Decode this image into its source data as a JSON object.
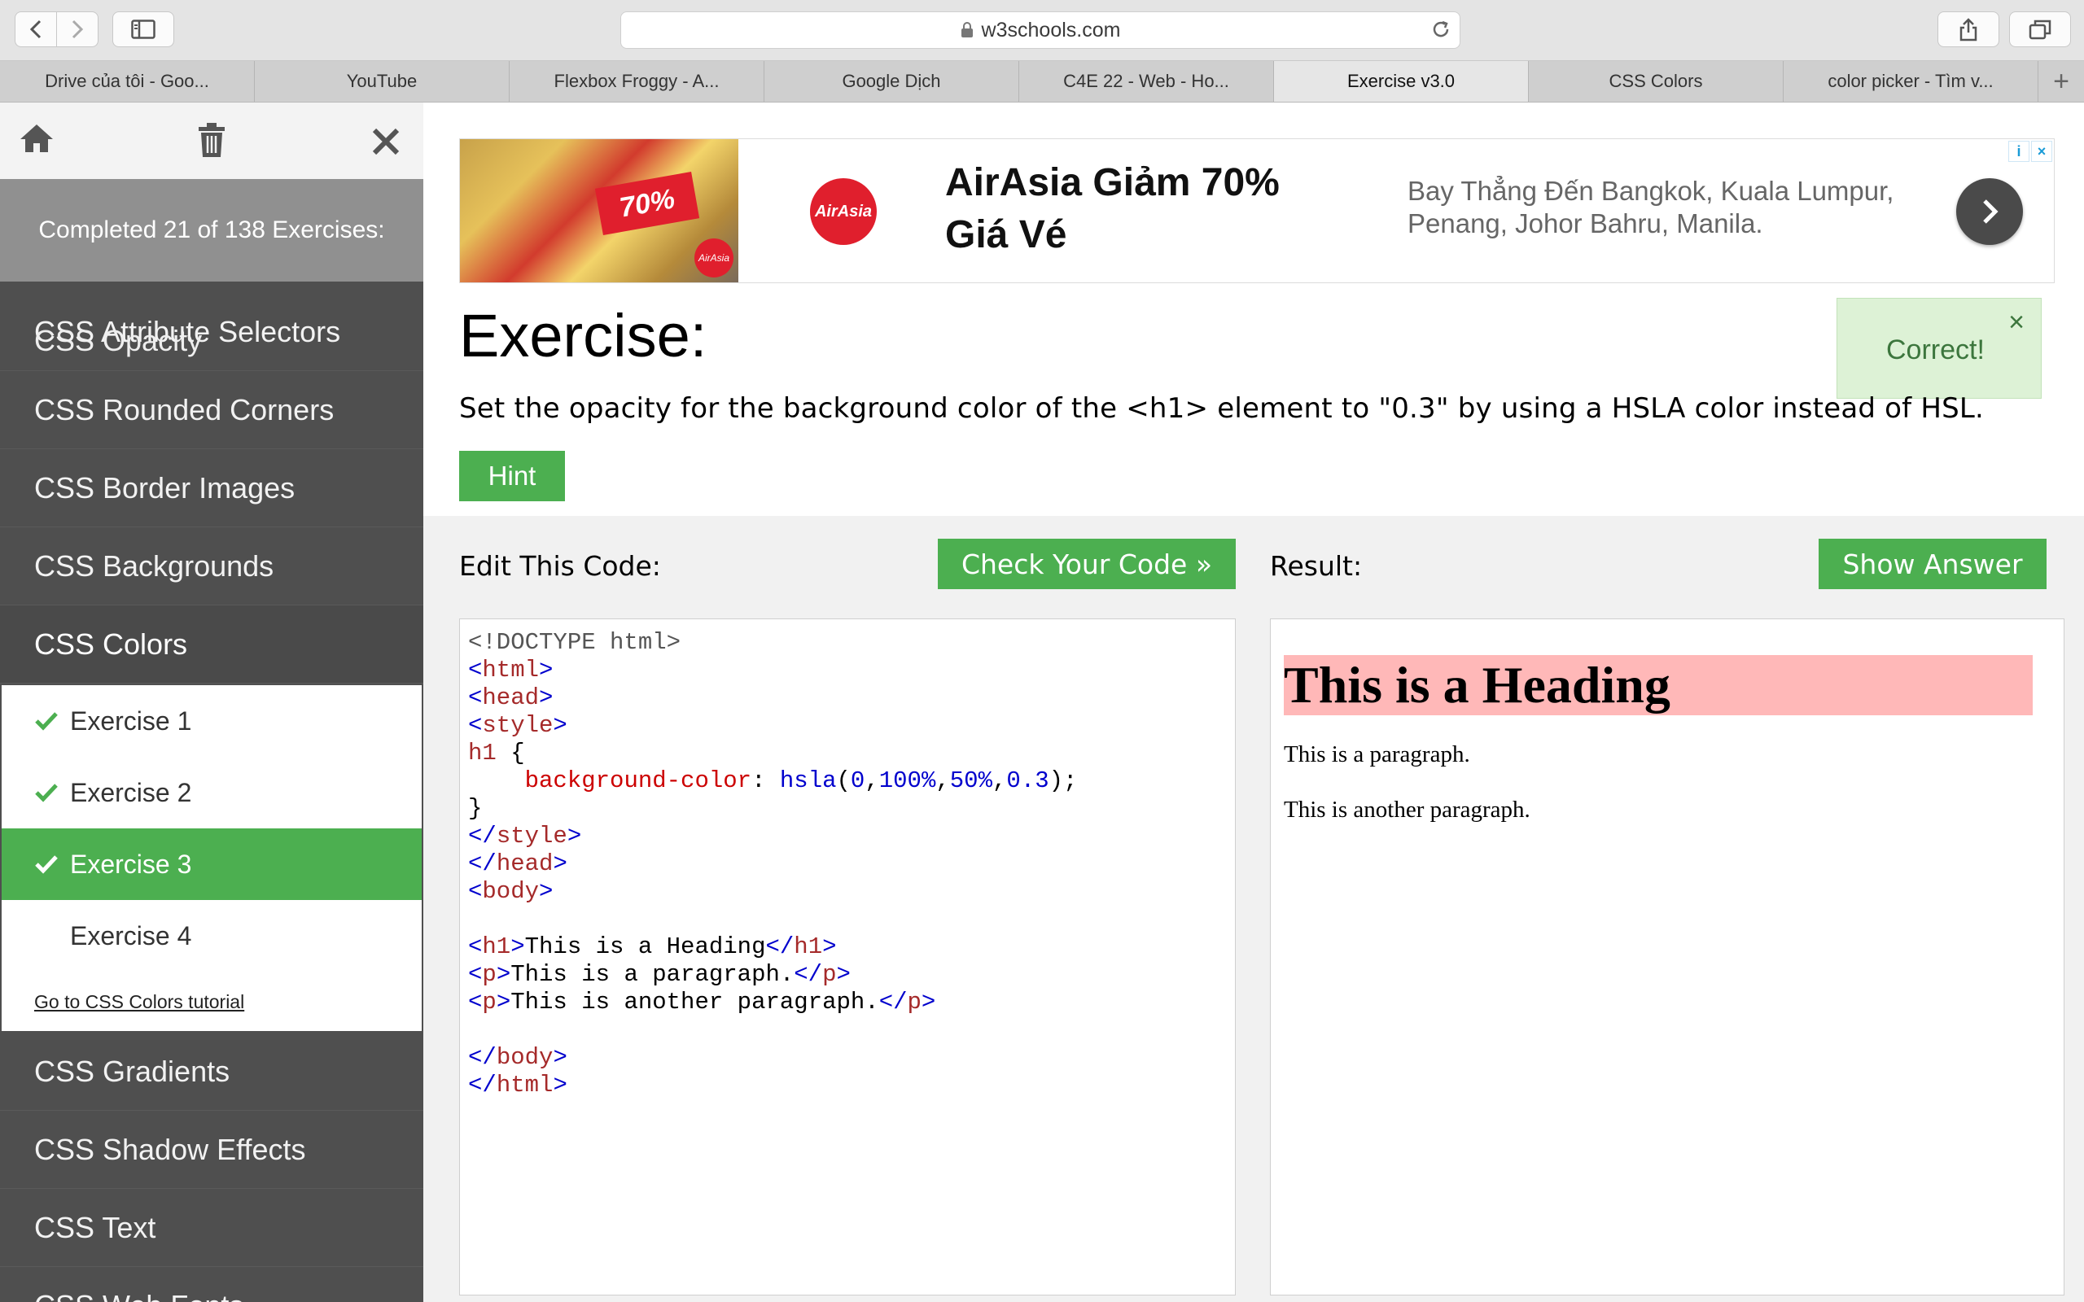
{
  "browser": {
    "url": "w3schools.com",
    "tabs": [
      {
        "label": "Drive của tôi - Goo...",
        "active": false
      },
      {
        "label": "YouTube",
        "active": false
      },
      {
        "label": "Flexbox Froggy - A...",
        "active": false
      },
      {
        "label": "Google Dịch",
        "active": false
      },
      {
        "label": "C4E 22 - Web - Ho...",
        "active": false
      },
      {
        "label": "Exercise v3.0",
        "active": true
      },
      {
        "label": "CSS Colors",
        "active": false
      },
      {
        "label": "color picker - Tìm v...",
        "active": false
      }
    ],
    "new_tab": "+"
  },
  "sidebar": {
    "completed_text": "Completed 21 of 138 Exercises:",
    "partial_item": "CSS Opacity",
    "items_before": [
      "CSS Attribute Selectors",
      "CSS Rounded Corners",
      "CSS Border Images",
      "CSS Backgrounds"
    ],
    "current_section": "CSS Colors",
    "exercises": [
      {
        "label": "Exercise 1",
        "done": true
      },
      {
        "label": "Exercise 2",
        "done": true
      },
      {
        "label": "Exercise 3",
        "done": true,
        "active": true
      },
      {
        "label": "Exercise 4",
        "done": false
      }
    ],
    "tutorial_link": "Go to CSS Colors tutorial",
    "items_after": [
      "CSS Gradients",
      "CSS Shadow Effects",
      "CSS Text",
      "CSS Web Fonts"
    ]
  },
  "ad": {
    "photo_tag": "70%",
    "brand": "AirAsia",
    "headline": "AirAsia Giảm 70% Giá Vé",
    "description": "Bay Thẳng Đến Bangkok, Kuala Lumpur, Penang, Johor Bahru, Manila.",
    "info": "i",
    "close": "×"
  },
  "exercise": {
    "title": "Exercise:",
    "correct_message": "Correct!",
    "correct_close": "×",
    "instruction": "Set the opacity for the background color of the <h1> element to \"0.3\" by using a HSLA color instead of HSL.",
    "hint_label": "Hint",
    "edit_label": "Edit This Code:",
    "check_label": "Check Your Code »",
    "result_label": "Result:",
    "answer_label": "Show Answer"
  },
  "code": {
    "doctype": "<!DOCTYPE html>",
    "html_open": "html",
    "head_open": "head",
    "style_open": "style",
    "selector": "h1",
    "brace_open": " {",
    "property": "background-color",
    "value_fn": "hsla",
    "value_args": [
      "0",
      "100%",
      "50%",
      "0.3"
    ],
    "brace_close": "}",
    "style_close": "style",
    "head_close": "head",
    "body_open": "body",
    "h1_text": "This is a Heading",
    "p1_text": "This is a paragraph.",
    "p2_text": "This is another paragraph.",
    "body_close": "body",
    "html_close": "html"
  },
  "result": {
    "heading": "This is a Heading",
    "p1": "This is a paragraph.",
    "p2": "This is another paragraph."
  },
  "colors": {
    "accent_green": "#4CAF50",
    "sidebar_dark": "#4f4f4f",
    "correct_bg": "#ddf2d6",
    "result_h1_bg": "hsla(0,100%,50%,0.3)"
  }
}
